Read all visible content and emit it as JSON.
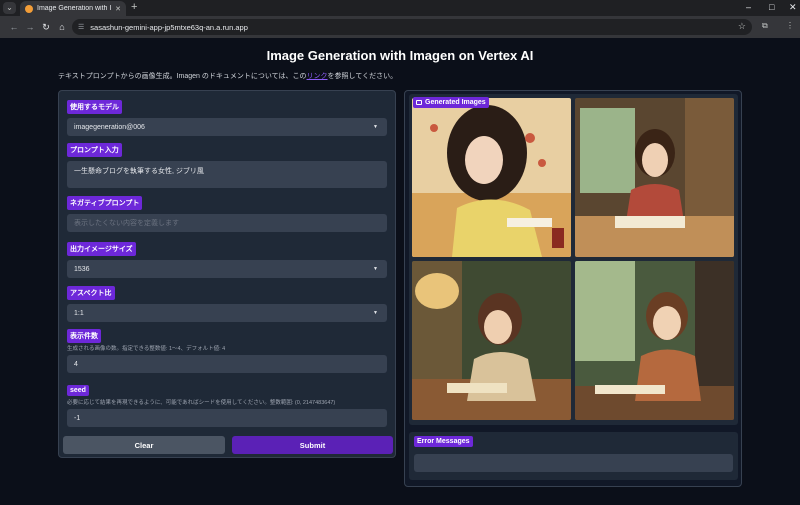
{
  "browser": {
    "tab_title": "Image Generation with Imagen",
    "url": "sasashun-gemini-app-jp5mtxe63q-an.a.run.app"
  },
  "page": {
    "title": "Image Generation with Imagen on Vertex AI",
    "desc_prefix": "テキストプロンプトからの画像生成。Imagen のドキュメントについては、この",
    "desc_link": "リンク",
    "desc_suffix": "を参照してください。"
  },
  "form": {
    "model": {
      "label": "使用するモデル",
      "value": "imagegeneration@006"
    },
    "prompt": {
      "label": "プロンプト入力",
      "value": "一生懸命ブログを執筆する女性, ジブリ風"
    },
    "negative": {
      "label": "ネガティブプロンプト",
      "placeholder": "表示したくない内容を定義します"
    },
    "size": {
      "label": "出力イメージサイズ",
      "value": "1536"
    },
    "aspect": {
      "label": "アスペクト比",
      "value": "1:1"
    },
    "count": {
      "label": "表示件数",
      "info": "生成される画像の数。指定できる整数値: 1〜4、デフォルト値: 4",
      "value": "4"
    },
    "seed": {
      "label": "seed",
      "info": "必要に応じて結果を再現できるように、可能であればシードを使用してください。整数範囲: (0, 2147483647)",
      "value": "-1"
    },
    "clear_label": "Clear",
    "submit_label": "Submit"
  },
  "output": {
    "gallery_label": "Generated Images",
    "error_label": "Error Messages"
  },
  "colors": {
    "accent": "#6d28d9",
    "submit": "#5b21b6",
    "background": "#0b0f19",
    "panel": "#1f2937"
  }
}
